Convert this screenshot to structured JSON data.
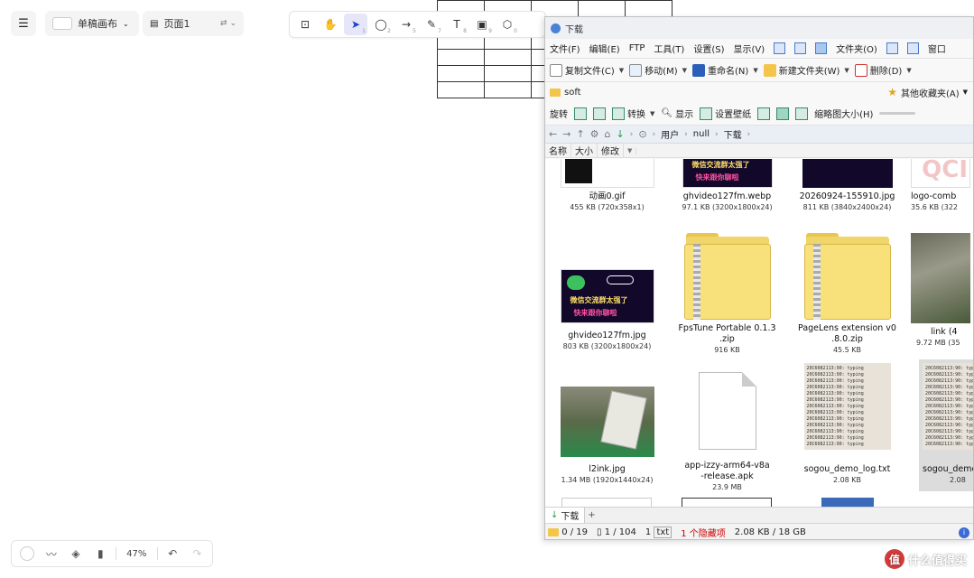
{
  "canvas": {
    "board_label": "单稿画布",
    "page_label": "页面1",
    "zoom": "47%"
  },
  "toolbar": {
    "tools": [
      {
        "name": "lock-icon",
        "glyph": "⊡",
        "sub": ""
      },
      {
        "name": "hand-icon",
        "glyph": "✋",
        "sub": ""
      },
      {
        "name": "pointer-icon",
        "glyph": "➤",
        "sub": "1"
      },
      {
        "name": "ellipse-icon",
        "glyph": "◯",
        "sub": "2"
      },
      {
        "name": "arrow-icon",
        "glyph": "→",
        "sub": "5"
      },
      {
        "name": "pen-icon",
        "glyph": "✎",
        "sub": "7"
      },
      {
        "name": "text-icon",
        "glyph": "T",
        "sub": "8"
      },
      {
        "name": "image-icon",
        "glyph": "▣",
        "sub": "9"
      },
      {
        "name": "shapes-icon",
        "glyph": "⬡",
        "sub": "0"
      }
    ]
  },
  "explorer": {
    "title": "下载",
    "menu": [
      "文件(F)",
      "编辑(E)",
      "FTP",
      "工具(T)",
      "设置(S)",
      "显示(V)",
      "文件夹(O)",
      "窗口"
    ],
    "commands": [
      "复制文件(C)",
      "移动(M)",
      "重命名(N)",
      "新建文件夹(W)",
      "删除(D)"
    ],
    "fav_folder": "soft",
    "fav_other": "其他收藏夹(A)",
    "view": {
      "rotate": "旋转",
      "convert": "转换",
      "show": "显示",
      "wallpaper": "设置壁纸",
      "thumb_size": "缩略图大小(H)"
    },
    "breadcrumb": [
      "用户",
      "null",
      "下载"
    ],
    "columns": [
      "名称",
      "大小",
      "修改"
    ],
    "files": [
      {
        "name": "动画0.gif",
        "size": "455 KB (720x358x1)"
      },
      {
        "name": "ghvideo127fm.webp",
        "size": "97.1 KB (3200x1800x24)"
      },
      {
        "name": "20260924-155910.jpg",
        "size": "811 KB (3840x2400x24)"
      },
      {
        "name": "logo-comb",
        "size": "35.6 KB (322"
      },
      {
        "name": "ghvideo127fm.jpg",
        "size": "803 KB (3200x1800x24)"
      },
      {
        "name": "FpsTune Portable 0.1.3",
        "name2": ".zip",
        "size": "916 KB"
      },
      {
        "name": "PageLens extension v0",
        "name2": ".8.0.zip",
        "size": "45.5 KB"
      },
      {
        "name": "link (4",
        "size": "9.72 MB (35"
      },
      {
        "name": "l2ink.jpg",
        "size": "1.34 MB (1920x1440x24)"
      },
      {
        "name": "app-izzy-arm64-v8a",
        "name2": "-release.apk",
        "size": "23.9 MB"
      },
      {
        "name": "sogou_demo_log.txt",
        "size": "2.08 KB"
      },
      {
        "name": "sogou_demo",
        "size": "2.08"
      }
    ],
    "banner_line1": "微信交流群太强了",
    "banner_line2": "快来跟你聊啦",
    "tab_label": "下载",
    "status": {
      "selected": "0 / 19",
      "files": "1 / 104",
      "type_count": "1",
      "type": "txt",
      "hidden": "1 个隐藏项",
      "disk": "2.08 KB / 18 GB"
    }
  },
  "watermark": {
    "badge": "值",
    "text": "什么值得买"
  },
  "colors": {
    "accent": "#1a3fd4",
    "folder": "#f3c54a",
    "banner_bg": "#12082a",
    "status_red": "#cc0000"
  }
}
